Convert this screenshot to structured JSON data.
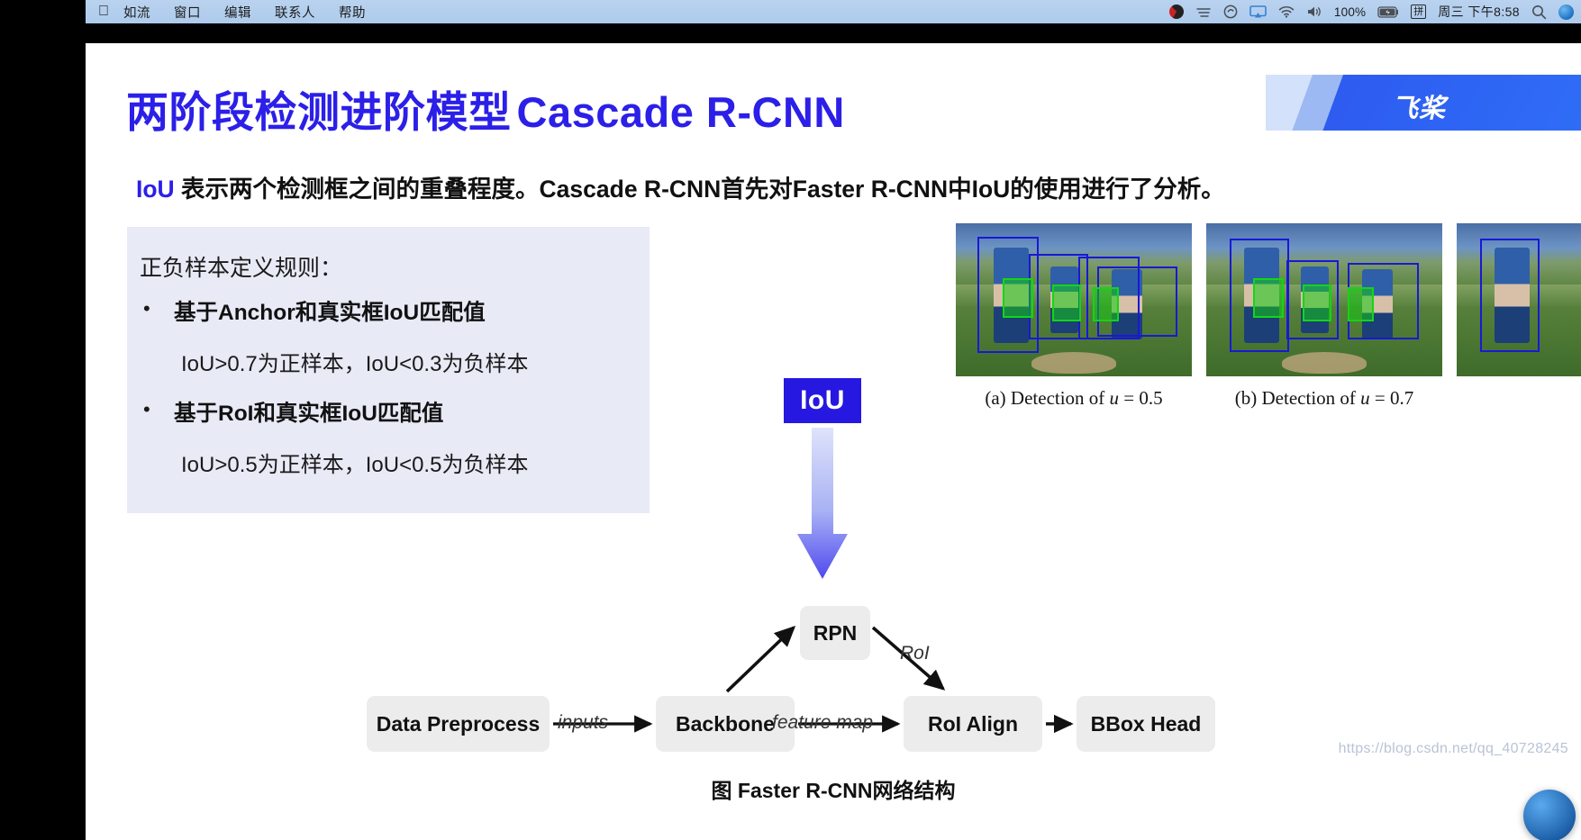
{
  "menubar": {
    "apple_icon": "apple-icon",
    "items": [
      "如流",
      "窗口",
      "编辑",
      "联系人",
      "帮助"
    ],
    "status": {
      "disc_icon": "disc-icon",
      "weather_icon": "weather-icon",
      "shield_icon": "shield-icon",
      "airplay_icon": "airplay-icon",
      "wifi_icon": "wifi-icon",
      "volume_icon": "volume-icon",
      "battery_percent": "100%",
      "battery_icon": "battery-charging-icon",
      "input_method": "拼",
      "clock": "周三 下午8:58",
      "search_icon": "search-icon",
      "globe_icon": "globe-icon"
    }
  },
  "slide": {
    "title_zh": "两阶段检测进阶模型",
    "title_en": "Cascade R-CNN",
    "title_color": "#2b1fe8",
    "brand": "飞桨",
    "subtitle": {
      "accent": "IoU",
      "rest": " 表示两个检测框之间的重叠程度。Cascade R-CNN首先对Faster R-CNN中IoU的使用进行了分析。"
    },
    "panel": {
      "heading": "正负样本定义规则：",
      "bullets": [
        {
          "marker": "•",
          "title": "基于Anchor和真实框IoU匹配值",
          "detail": "IoU>0.7为正样本，IoU<0.3为负样本"
        },
        {
          "marker": "•",
          "title": "基于RoI和真实框IoU匹配值",
          "detail": "IoU>0.5为正样本，IoU<0.5为负样本"
        }
      ],
      "bg_color": "#e8eaf6"
    },
    "iou_badge": {
      "label": "IoU",
      "bg_color": "#2618e0",
      "arrow_icon": "arrow-down-icon"
    },
    "detection_figure": {
      "captions": [
        {
          "index": "(a)",
          "text": "Detection of ",
          "var": "u",
          "eq": " = 0.5"
        },
        {
          "index": "(b)",
          "text": "Detection of ",
          "var": "u",
          "eq": " = 0.7"
        }
      ],
      "box_color": "#1818d8",
      "mask_color": "#13d613"
    },
    "flow": {
      "nodes": [
        {
          "id": "data-preprocess",
          "label": "Data Preprocess"
        },
        {
          "id": "backbone",
          "label": "Backbone"
        },
        {
          "id": "rpn",
          "label": "RPN"
        },
        {
          "id": "roi-align",
          "label": "RoI Align"
        },
        {
          "id": "bbox-head",
          "label": "BBox Head"
        }
      ],
      "edge_labels": [
        {
          "id": "inputs",
          "label": "inputs"
        },
        {
          "id": "feature-map",
          "label": "feature map"
        },
        {
          "id": "roi",
          "label": "RoI"
        }
      ],
      "caption": "图 Faster R-CNN网络结构",
      "node_bg": "#ececec"
    },
    "watermark": "https://blog.csdn.net/qq_40728245"
  }
}
